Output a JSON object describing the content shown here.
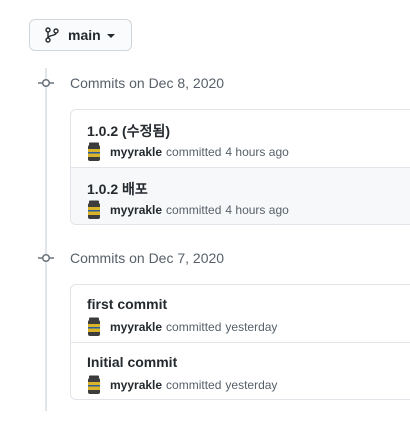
{
  "branch": {
    "name": "main",
    "icon": "git-branch-icon"
  },
  "groups": [
    {
      "date_label": "Commits on Dec 8, 2020",
      "commits": [
        {
          "title": "1.0.2 (수정됨)",
          "author": "myyrakle",
          "verb": "committed",
          "time": "4 hours ago",
          "highlighted": false
        },
        {
          "title": "1.0.2 배포",
          "author": "myyrakle",
          "verb": "committed",
          "time": "4 hours ago",
          "highlighted": true
        }
      ]
    },
    {
      "date_label": "Commits on Dec 7, 2020",
      "commits": [
        {
          "title": "first commit",
          "author": "myyrakle",
          "verb": "committed",
          "time": "yesterday",
          "highlighted": false
        },
        {
          "title": "Initial commit",
          "author": "myyrakle",
          "verb": "committed",
          "time": "yesterday",
          "highlighted": false
        }
      ]
    }
  ],
  "colors": {
    "border": "#e1e4e8",
    "muted_text": "#586069",
    "primary_text": "#24292e",
    "highlight_bg": "#f6f8fa"
  }
}
